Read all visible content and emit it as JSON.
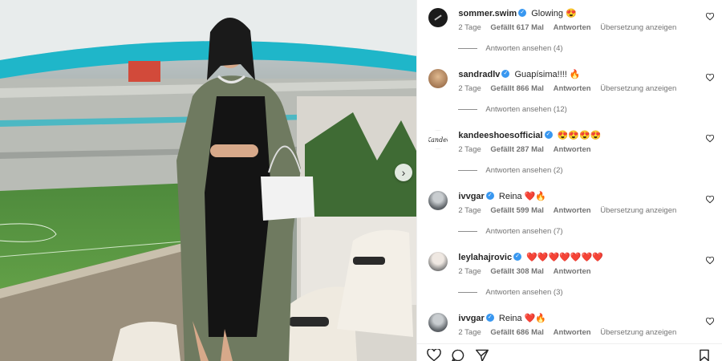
{
  "post": {
    "image_alt": ""
  },
  "comments": [
    {
      "username": "sommer.swim",
      "text": "Glowing 😍",
      "time": "2 Tage",
      "likes": "Gefällt 617 Mal",
      "reply_label": "Antworten",
      "translate_label": "Übersetzung anzeigen",
      "view_replies": "Antworten ansehen (4)",
      "avatar_style": "dark"
    },
    {
      "username": "sandradlv",
      "text": "Guapísima!!!! 🔥",
      "time": "2 Tage",
      "likes": "Gefällt 866 Mal",
      "reply_label": "Antworten",
      "translate_label": "Übersetzung anzeigen",
      "view_replies": "Antworten ansehen (12)",
      "avatar_style": "tan"
    },
    {
      "username": "kandeeshoesofficial",
      "text": "😍😍😍😍",
      "time": "2 Tage",
      "likes": "Gefällt 287 Mal",
      "reply_label": "Antworten",
      "translate_label": "",
      "view_replies": "Antworten ansehen (2)",
      "avatar_style": "script",
      "avatar_text": "Kandee"
    },
    {
      "username": "ivvgar",
      "text": "Reina ❤️🔥",
      "time": "2 Tage",
      "likes": "Gefällt 599 Mal",
      "reply_label": "Antworten",
      "translate_label": "Übersetzung anzeigen",
      "view_replies": "Antworten ansehen (7)",
      "avatar_style": "gray"
    },
    {
      "username": "leylahajrovic",
      "text": "❤️❤️❤️❤️❤️❤️❤️",
      "time": "2 Tage",
      "likes": "Gefällt 308 Mal",
      "reply_label": "Antworten",
      "translate_label": "",
      "view_replies": "Antworten ansehen (3)",
      "avatar_style": "light"
    },
    {
      "username": "ivvgar",
      "text": "Reina ❤️🔥",
      "time": "2 Tage",
      "likes": "Gefällt 686 Mal",
      "reply_label": "Antworten",
      "translate_label": "Übersetzung anzeigen",
      "view_replies": "",
      "avatar_style": "gray"
    }
  ],
  "icons": {
    "verified": "verified-badge-icon",
    "comment_like": "heart-outline-icon",
    "like": "heart-icon",
    "comment": "comment-icon",
    "share": "paper-plane-icon",
    "save": "bookmark-icon",
    "next": "chevron-right-icon"
  },
  "colors": {
    "verified": "#3897f0",
    "text": "#262626",
    "meta": "#737373"
  }
}
